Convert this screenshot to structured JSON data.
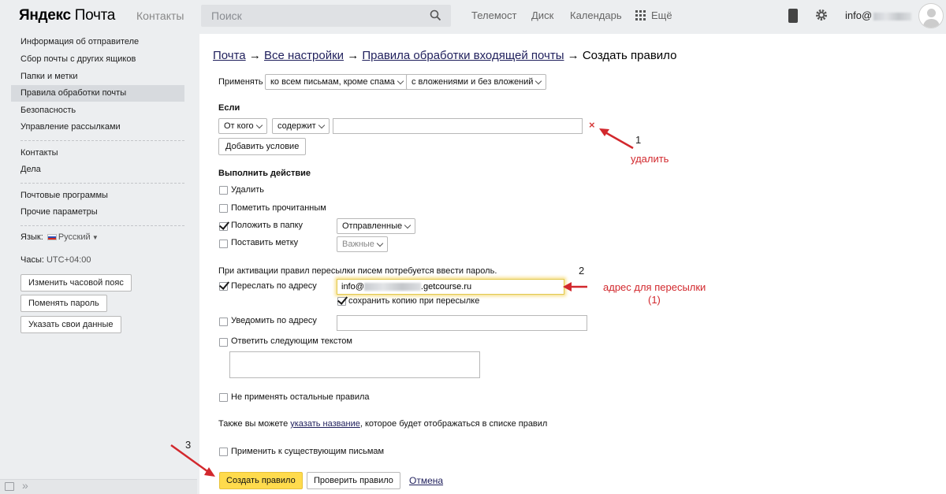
{
  "header": {
    "logo_bold": "Яндекс",
    "logo_rest": " Почта",
    "contacts": "Контакты",
    "search_placeholder": "Поиск",
    "nav": [
      "Телемост",
      "Диск",
      "Календарь",
      "Ещё"
    ],
    "user": "info@"
  },
  "sidebar": {
    "items": [
      "Информация об отправителе",
      "Сбор почты с других ящиков",
      "Папки и метки",
      "Правила обработки почты",
      "Безопасность",
      "Управление рассылками"
    ],
    "items2": [
      "Контакты",
      "Дела"
    ],
    "items3": [
      "Почтовые программы",
      "Прочие параметры"
    ],
    "lang_label": "Язык:",
    "lang_value": "Русский",
    "tz_label": "Часы:",
    "tz_value": "UTC+04:00",
    "buttons": [
      "Изменить часовой пояс",
      "Поменять пароль",
      "Указать свои данные"
    ]
  },
  "main": {
    "crumb1": "Почта",
    "crumb2": "Все настройки",
    "crumb3": "Правила обработки входящей почты",
    "crumb_current": "Создать правило",
    "arrow": "→",
    "apply_label": "Применять",
    "apply_select1": "ко всем письмам, кроме спама",
    "apply_select2": "с вложениями и без вложений",
    "if_heading": "Если",
    "cond_field": "От кого",
    "cond_op": "содержит",
    "cond_value": "",
    "delete_mark": "×",
    "add_condition": "Добавить условие",
    "action_heading": "Выполнить действие",
    "actions": {
      "delete": "Удалить",
      "mark_read": "Пометить прочитанным",
      "move_folder": "Положить в папку",
      "folder_value": "Отправленные",
      "set_label": "Поставить метку",
      "label_value": "Важные"
    },
    "forward_note": "При активации правил пересылки писем потребуется ввести пароль.",
    "forward_label": "Переслать по адресу",
    "forward_value_start": "info@",
    "forward_value_end": ".getcourse.ru",
    "keep_copy": "сохранить копию при пересылке",
    "notify_label": "Уведомить по адресу",
    "reply_label": "Ответить следующим текстом",
    "no_other_rules": "Не применять остальные правила",
    "name_note_before": "Также вы можете ",
    "name_link": "указать название",
    "name_note_after": ", которое будет отображаться в списке правил",
    "apply_existing": "Применить к существующим письмам",
    "create_button": "Создать правило",
    "check_button": "Проверить правило",
    "cancel_link": "Отмена"
  },
  "annotations": {
    "num1": "1",
    "text1": "удалить",
    "num2": "2",
    "text2_line1": "адрес для пересылки",
    "text2_line2": "(1)",
    "num3": "3"
  },
  "colors": {
    "accent_yellow": "#ffdb4d",
    "annotation_red": "#d2282d"
  }
}
